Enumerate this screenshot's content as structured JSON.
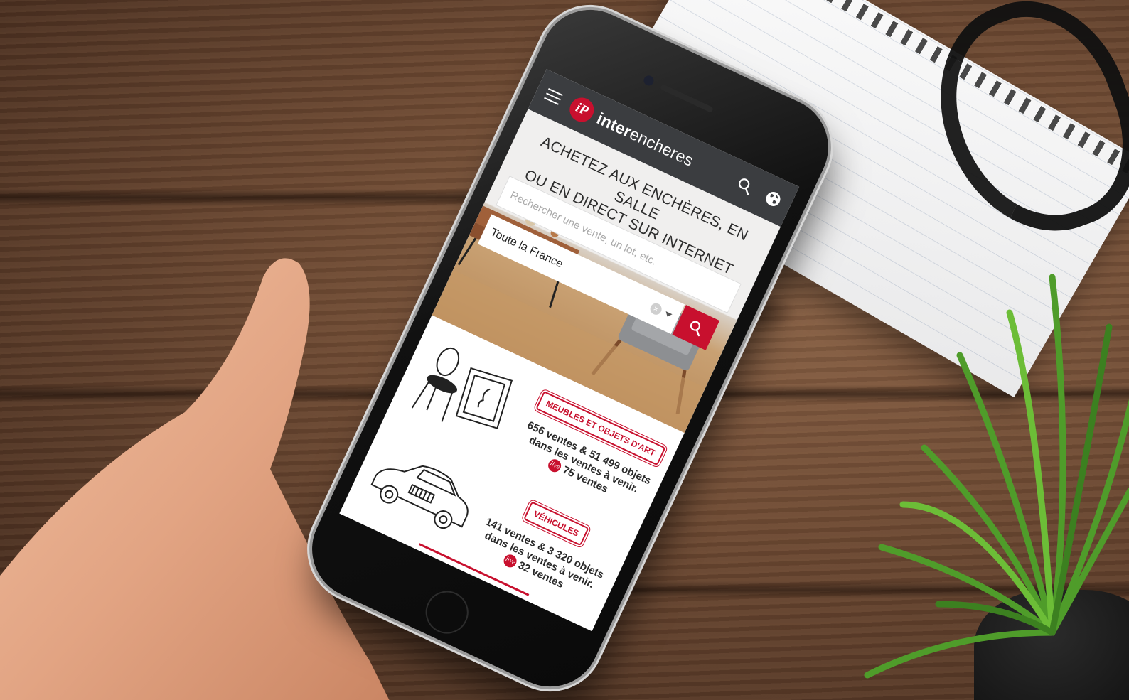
{
  "colors": {
    "brand_red": "#c8102e",
    "app_bar": "#3b3d40",
    "screen_bg": "#ffffff"
  },
  "app_bar": {
    "logo_mark": "iP",
    "logo_bold": "inter",
    "logo_regular": "encheres",
    "icons": [
      "hamburger-menu-icon",
      "search-icon",
      "globe-icon"
    ]
  },
  "hero": {
    "title_line1": "ACHETEZ AUX ENCHÈRES, EN SALLE",
    "title_line2": "OU EN DIRECT SUR INTERNET",
    "search_placeholder": "Rechercher une vente, un lot, etc.",
    "location_value": "Toute la France"
  },
  "categories": [
    {
      "badge": "MEUBLES ET OBJETS D'ART",
      "stats_line1": "656 ventes & 51 499 objets",
      "stats_line2": "dans les ventes à venir.",
      "live_label": "live",
      "live_count": "75 ventes",
      "icon": "chair-and-painting-illustration"
    },
    {
      "badge": "VÉHICULES",
      "stats_line1": "141 ventes & 3 320 objets",
      "stats_line2": "dans les ventes à venir.",
      "live_label": "live",
      "live_count": "32 ventes",
      "icon": "classic-car-illustration"
    }
  ]
}
